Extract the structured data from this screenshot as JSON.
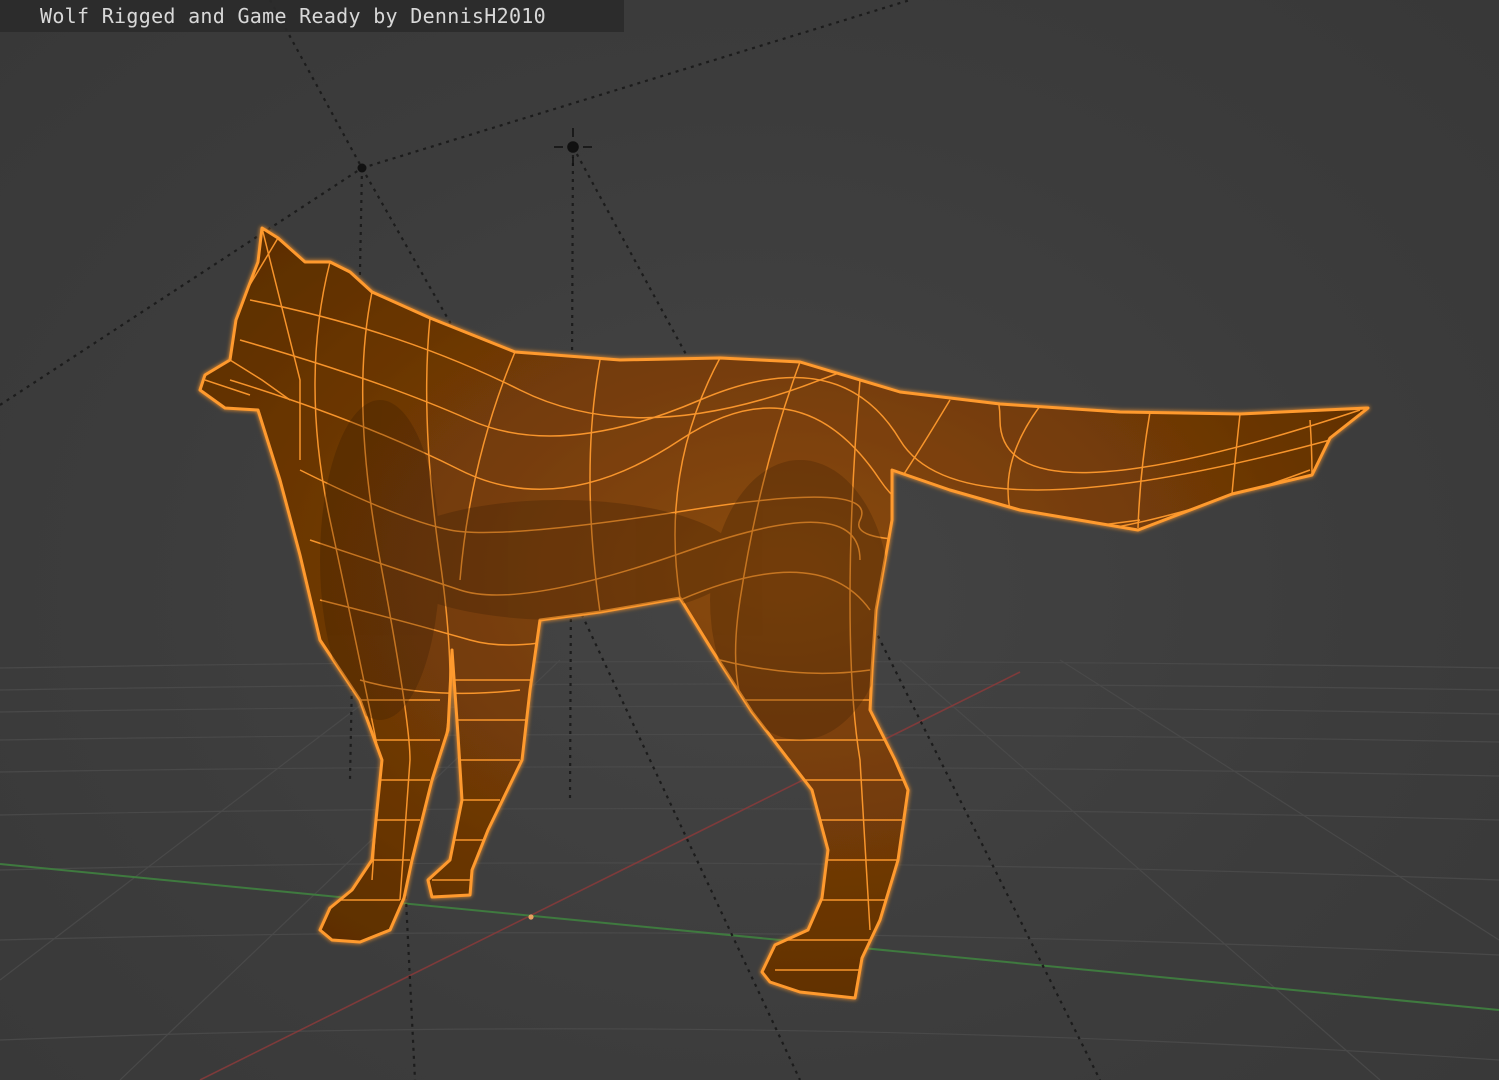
{
  "viewport": {
    "title": "Wolf Rigged and Game Ready by DennisH2010",
    "object": "wolf-mesh",
    "display_mode": "wireframe-overlay",
    "colors": {
      "background": "#3d3d3d",
      "grid": "#4a4a4a",
      "x_axis": "#8a3a3a",
      "y_axis": "#3f7a3f",
      "mesh_fill": "#7a3f08",
      "wire": "#ff9a2e",
      "rig_lines": "#1c1c1c"
    }
  }
}
